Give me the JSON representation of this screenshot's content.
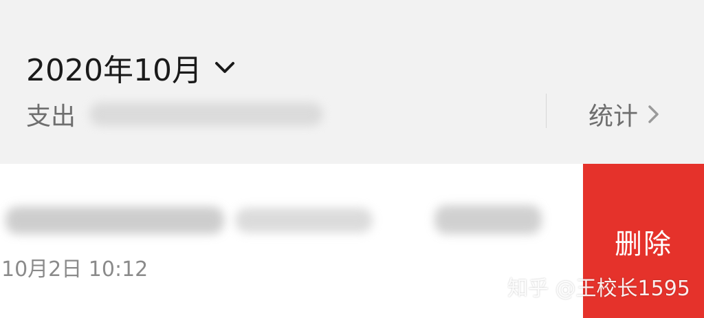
{
  "header": {
    "month": "2020年10月",
    "expense_label": "支出",
    "stats_label": "统计"
  },
  "row": {
    "time": "10月2日 10:12"
  },
  "actions": {
    "delete_label": "删除"
  },
  "watermark": {
    "text": "知乎 @王校长1595"
  },
  "colors": {
    "delete_red": "#e5322b",
    "background": "#f2f2f2",
    "row_background": "#ffffff"
  }
}
